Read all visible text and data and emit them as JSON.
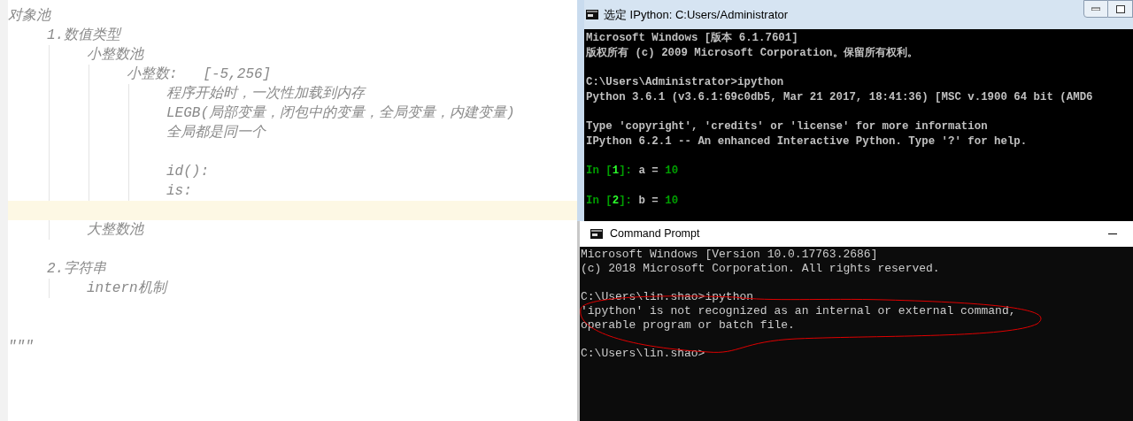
{
  "editor": {
    "lines": [
      {
        "kind": "text",
        "text": "对象池",
        "children": [
          {
            "kind": "text",
            "text": "1.数值类型",
            "children": [
              {
                "kind": "text",
                "text": "小整数池",
                "children": [
                  {
                    "kind": "text",
                    "text": "小整数:   [-5,256]",
                    "children": [
                      {
                        "kind": "text",
                        "text": "程序开始时，一次性加载到内存"
                      },
                      {
                        "kind": "text",
                        "text": "LEGB(局部变量，闭包中的变量，全局变量，内建变量)"
                      },
                      {
                        "kind": "text",
                        "text": "全局都是同一个"
                      },
                      {
                        "kind": "blank"
                      },
                      {
                        "kind": "text",
                        "text": "id():"
                      },
                      {
                        "kind": "text",
                        "text": "is:"
                      }
                    ]
                  }
                ]
              },
              {
                "kind": "blank",
                "current": true
              },
              {
                "kind": "text",
                "text": "大整数池"
              }
            ]
          },
          {
            "kind": "blank"
          },
          {
            "kind": "text",
            "text": "2.字符串",
            "children": [
              {
                "kind": "text",
                "text": "intern机制"
              }
            ]
          }
        ]
      },
      {
        "kind": "blank"
      },
      {
        "kind": "blank"
      },
      {
        "kind": "text",
        "text": "\"\"\""
      }
    ]
  },
  "ipython_window": {
    "title": "选定 IPython: C:Users/Administrator",
    "lines": [
      {
        "kind": "output",
        "text": "Microsoft Windows [版本 6.1.7601]"
      },
      {
        "kind": "output",
        "text": "版权所有 (c) 2009 Microsoft Corporation。保留所有权利。"
      },
      {
        "kind": "blank"
      },
      {
        "kind": "output",
        "text": "C:\\Users\\Administrator>ipython"
      },
      {
        "kind": "output",
        "text": "Python 3.6.1 (v3.6.1:69c0db5, Mar 21 2017, 18:41:36) [MSC v.1900 64 bit (AMD6"
      },
      {
        "kind": "blank"
      },
      {
        "kind": "output",
        "text": "Type 'copyright', 'credits' or 'license' for more information"
      },
      {
        "kind": "output",
        "text": "IPython 6.2.1 -- An enhanced Interactive Python. Type '?' for help."
      },
      {
        "kind": "blank"
      },
      {
        "kind": "input",
        "prompt_open": "In [",
        "number": "1",
        "prompt_close": "]: ",
        "code": "a = ",
        "value": "10"
      },
      {
        "kind": "blank"
      },
      {
        "kind": "input",
        "prompt_open": "In [",
        "number": "2",
        "prompt_close": "]: ",
        "code": "b = ",
        "value": "10"
      }
    ]
  },
  "cmd_window": {
    "title": "Command Prompt",
    "lines": [
      {
        "kind": "output",
        "text": "Microsoft Windows [Version 10.0.17763.2686]"
      },
      {
        "kind": "output",
        "text": "(c) 2018 Microsoft Corporation. All rights reserved."
      },
      {
        "kind": "blank"
      },
      {
        "kind": "output",
        "text": "C:\\Users\\lin.shao>ipython"
      },
      {
        "kind": "output",
        "text": "'ipython' is not recognized as an internal or external command,"
      },
      {
        "kind": "output",
        "text": "operable program or batch file."
      },
      {
        "kind": "blank"
      },
      {
        "kind": "output",
        "text": "C:\\Users\\lin.shao>"
      }
    ]
  }
}
